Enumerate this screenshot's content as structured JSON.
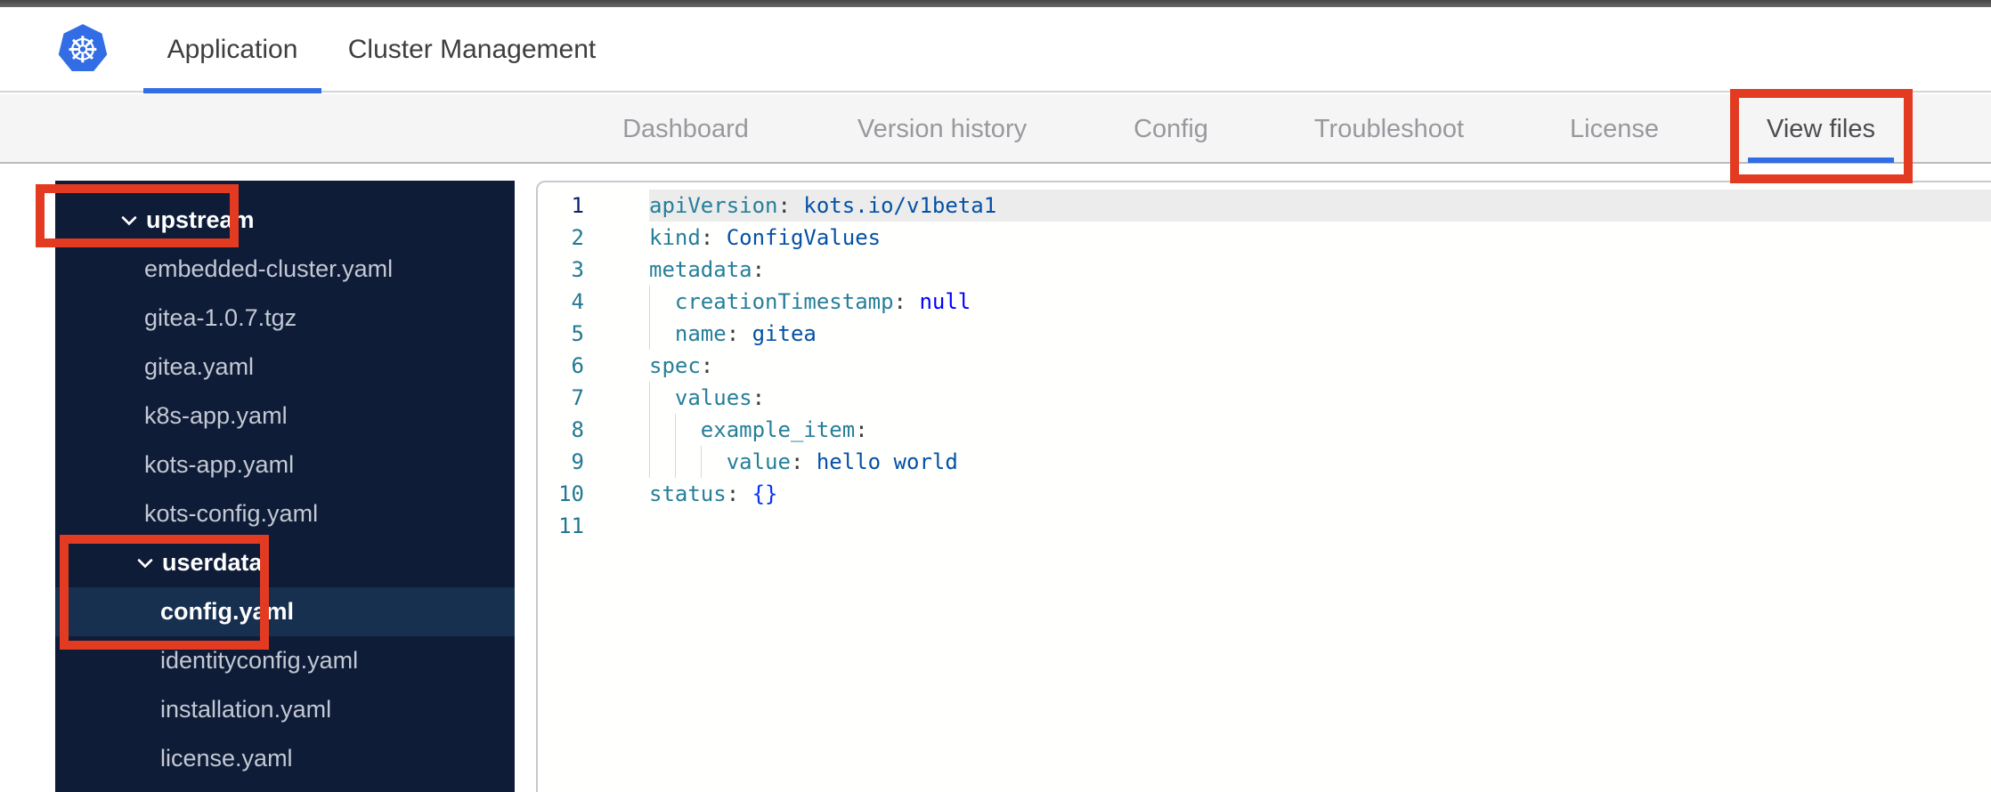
{
  "topbar": {
    "tabs": [
      {
        "label": "Application",
        "active": true
      },
      {
        "label": "Cluster Management",
        "active": false
      }
    ]
  },
  "subnav": {
    "tabs": [
      {
        "label": "Dashboard",
        "active": false
      },
      {
        "label": "Version history",
        "active": false
      },
      {
        "label": "Config",
        "active": false
      },
      {
        "label": "Troubleshoot",
        "active": false
      },
      {
        "label": "License",
        "active": false
      },
      {
        "label": "View files",
        "active": true
      }
    ]
  },
  "file_tree": {
    "items": [
      {
        "label": "upstream",
        "type": "folder",
        "level": 0,
        "expanded": true
      },
      {
        "label": "embedded-cluster.yaml",
        "type": "file",
        "level": 1
      },
      {
        "label": "gitea-1.0.7.tgz",
        "type": "file",
        "level": 1
      },
      {
        "label": "gitea.yaml",
        "type": "file",
        "level": 1
      },
      {
        "label": "k8s-app.yaml",
        "type": "file",
        "level": 1
      },
      {
        "label": "kots-app.yaml",
        "type": "file",
        "level": 1
      },
      {
        "label": "kots-config.yaml",
        "type": "file",
        "level": 1
      },
      {
        "label": "userdata",
        "type": "folder",
        "level": 1,
        "expanded": true
      },
      {
        "label": "config.yaml",
        "type": "file",
        "level": 2,
        "selected": true
      },
      {
        "label": "identityconfig.yaml",
        "type": "file",
        "level": 2
      },
      {
        "label": "installation.yaml",
        "type": "file",
        "level": 2
      },
      {
        "label": "license.yaml",
        "type": "file",
        "level": 2
      }
    ]
  },
  "editor": {
    "language": "yaml",
    "lines": [
      {
        "num": 1,
        "current": true,
        "guides": 0,
        "tokens": [
          [
            "key",
            "apiVersion"
          ],
          [
            "punc",
            ": "
          ],
          [
            "val",
            "kots.io/v1beta1"
          ]
        ]
      },
      {
        "num": 2,
        "guides": 0,
        "tokens": [
          [
            "key",
            "kind"
          ],
          [
            "punc",
            ": "
          ],
          [
            "val",
            "ConfigValues"
          ]
        ]
      },
      {
        "num": 3,
        "guides": 0,
        "tokens": [
          [
            "key",
            "metadata"
          ],
          [
            "punc",
            ":"
          ]
        ]
      },
      {
        "num": 4,
        "guides": 1,
        "tokens": [
          [
            "punc",
            "  "
          ],
          [
            "key",
            "creationTimestamp"
          ],
          [
            "punc",
            ": "
          ],
          [
            "kw",
            "null"
          ]
        ]
      },
      {
        "num": 5,
        "guides": 1,
        "tokens": [
          [
            "punc",
            "  "
          ],
          [
            "key",
            "name"
          ],
          [
            "punc",
            ": "
          ],
          [
            "val",
            "gitea"
          ]
        ]
      },
      {
        "num": 6,
        "guides": 0,
        "tokens": [
          [
            "key",
            "spec"
          ],
          [
            "punc",
            ":"
          ]
        ]
      },
      {
        "num": 7,
        "guides": 1,
        "tokens": [
          [
            "punc",
            "  "
          ],
          [
            "key",
            "values"
          ],
          [
            "punc",
            ":"
          ]
        ]
      },
      {
        "num": 8,
        "guides": 2,
        "tokens": [
          [
            "punc",
            "    "
          ],
          [
            "key",
            "example_item"
          ],
          [
            "punc",
            ":"
          ]
        ]
      },
      {
        "num": 9,
        "guides": 3,
        "tokens": [
          [
            "punc",
            "      "
          ],
          [
            "key",
            "value"
          ],
          [
            "punc",
            ": "
          ],
          [
            "val",
            "hello world"
          ]
        ]
      },
      {
        "num": 10,
        "guides": 0,
        "tokens": [
          [
            "key",
            "status"
          ],
          [
            "punc",
            ": "
          ],
          [
            "br",
            "{}"
          ]
        ]
      },
      {
        "num": 11,
        "guides": 0,
        "tokens": []
      }
    ]
  },
  "annotations": {
    "red_boxes": [
      "upstream-folder",
      "userdata-and-config-yaml",
      "view-files-tab"
    ]
  },
  "colors": {
    "k8s_blue": "#326de6",
    "annotation_red": "#e23b22",
    "sidebar_bg": "#0f1c37",
    "sidebar_selected_bg": "#173050",
    "sidebar_file_text": "#c3c9d4",
    "nav_bg": "#f5f5f6",
    "nav_text": "#97999d",
    "nav_text_active": "#4b4d50",
    "yaml_key": "#267f99",
    "yaml_value": "#0451a5",
    "yaml_keyword": "#0000ff",
    "yaml_bracket": "#0431fa",
    "line_number": "#237893",
    "line_number_active": "#0b216f",
    "current_line_bg": "#ececec"
  }
}
